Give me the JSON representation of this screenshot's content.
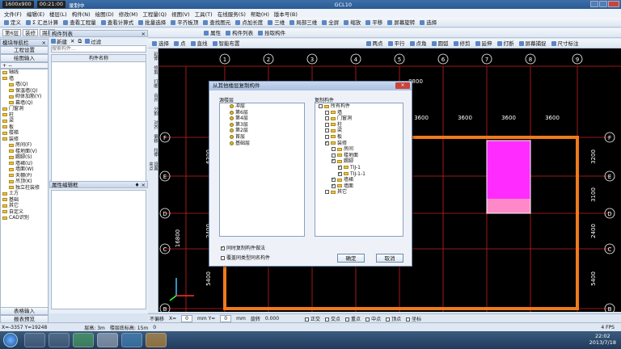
{
  "titlebar": {
    "rec_resolution": "1600x900",
    "rec_time": "00:21:00",
    "rec_label": "录制中",
    "app_title": "GCL10"
  },
  "menu": [
    "文件(F)",
    "编辑(E)",
    "楼层(L)",
    "构件(N)",
    "绘图(D)",
    "修改(M)",
    "工程量(Q)",
    "视图(V)",
    "工具(T)",
    "在线服务(S)",
    "帮助(H)",
    "版本号(B)"
  ],
  "toolbar1": [
    "定义",
    "Σ 汇总计算",
    "查看工程量",
    "查看计算式",
    "批量选择",
    "平齐板顶",
    "查找图元",
    "点加长度",
    "三维",
    "局部三维",
    "全屏",
    "缩放",
    "平移",
    "屏幕旋转",
    "选择"
  ],
  "toolbar2": {
    "floor": "第6层",
    "category": "装修",
    "component": "踢脚",
    "buttons": [
      "属性",
      "构件列表",
      "拾取构件"
    ]
  },
  "toolbar3": [
    "选择",
    "点",
    "直线",
    "智能布置"
  ],
  "toolbar3_right": [
    "两点",
    "平行",
    "点角",
    "圆弧",
    "修剪",
    "延伸",
    "打断",
    "屏幕捕捉",
    "尺寸标注"
  ],
  "left_panel": {
    "title": "模块导航栏",
    "tabs": [
      "工程设置",
      "绘图输入"
    ],
    "tree": [
      "轴线",
      "墙",
      "墙(Q)",
      "保温墙(Q)",
      "砌体加筋(Y)",
      "幕墙(Q)",
      "门窗洞",
      "柱",
      "梁",
      "板",
      "楼梯",
      "装修",
      "房间(F)",
      "楼地面(V)",
      "踢脚(S)",
      "墙裙(U)",
      "墙面(W)",
      "天棚(P)",
      "吊顶(K)",
      "独立柱装修",
      "土方",
      "基础",
      "其它",
      "自定义",
      "CAD识别"
    ],
    "bottom_buttons": [
      "表格输入",
      "报表预览"
    ]
  },
  "comp_list": {
    "title": "构件列表",
    "buttons": [
      "新建",
      "过滤"
    ],
    "search_placeholder": "搜索构件...",
    "column_header": "构件名称"
  },
  "props": {
    "title": "属性编辑框"
  },
  "vtool": [
    "延伸",
    "修剪",
    "打断",
    "合并",
    "分割",
    "对齐",
    "偏移",
    "拉伸",
    "设置夹点"
  ],
  "cad": {
    "axis_top": [
      "1",
      "2",
      "3",
      "4",
      "5",
      "6",
      "7",
      "8",
      "9"
    ],
    "axis_left": [
      "F",
      "E",
      "D",
      "C",
      "B"
    ],
    "dims_top": [
      "3600",
      "3600",
      "3600",
      "3600"
    ],
    "dims_right": [
      "3200",
      "3100",
      "2400",
      "5400"
    ],
    "dims_left": [
      "6300",
      "2400",
      "16800",
      "5400"
    ],
    "partial_dim": "8800"
  },
  "dialog": {
    "title": "从其他楼层复制构件",
    "close": "×",
    "source_label": "源楼层",
    "source_items": [
      "冲层",
      "第6层",
      "第4层",
      "第3层",
      "第2层",
      "首层",
      "基础层"
    ],
    "target_label": "复制构件",
    "target_items": [
      "所有构件",
      "墙",
      "门窗洞",
      "柱",
      "梁",
      "板",
      "装修",
      "房间",
      "楼地面",
      "踢脚",
      "TIJ-1",
      "TIJ-1-1",
      "墙裙",
      "墙面",
      "其它"
    ],
    "options": [
      "同时复制构件做法",
      "覆盖同类型同名构件"
    ],
    "ok": "确定",
    "cancel": "取消"
  },
  "status_bottom": [
    "不偏移",
    "X=",
    "0",
    "mm Y=",
    "0",
    "mm",
    "旋转",
    "0.000"
  ],
  "status_snap": [
    "正交",
    "交点",
    "重点",
    "中点",
    "顶点",
    "坐标"
  ],
  "statusbar": {
    "coords": "X=-3357  Y=19248",
    "floor_height": "层高: 3m",
    "base_elev": "楼层底标高: 15m",
    "value": "0",
    "fps": "4 FPS"
  },
  "clock": {
    "time": "22:02",
    "date": "2013/7/18"
  }
}
